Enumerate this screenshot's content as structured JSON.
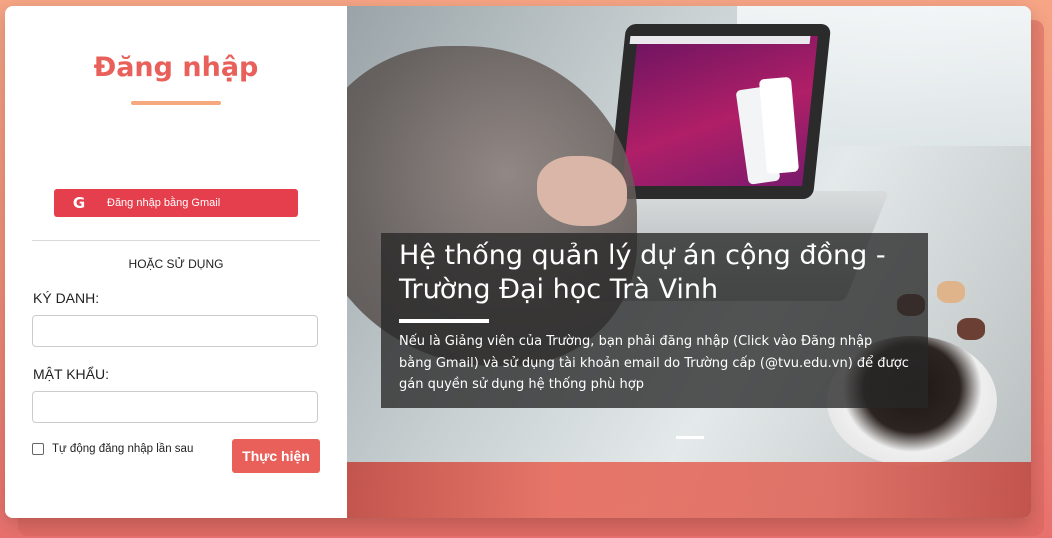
{
  "login": {
    "title": "Đăng nhập",
    "gmail_button": {
      "icon": "google-icon",
      "icon_glyph": "G",
      "label": "Đăng nhập bằng Gmail"
    },
    "or_text": "HOẶC SỬ DỤNG",
    "username_label": "KÝ DANH:",
    "username_value": "",
    "password_label": "MẬT KHẨU:",
    "password_value": "",
    "remember_label": "Tự động đăng nhập lần sau",
    "remember_checked": false,
    "submit_label": "Thực hiện"
  },
  "hero": {
    "caption_title": "Hệ thống quản lý dự án cộng đồng - Trường Đại học Trà Vinh",
    "caption_text": "Nếu là Giảng viên của Trường, bạn phải đăng nhập (Click vào Đăng nhập bằng Gmail) và sử dụng tài khoản email do Trường cấp (@tvu.edu.vn) để được gán quyền sử dụng hệ thống phù hợp",
    "slide_count": 1,
    "active_slide": 1
  },
  "colors": {
    "accent": "#e9605a",
    "gmail": "#e53e4c",
    "underline": "#f6a97e",
    "background_top": "#f6a585",
    "background_bottom": "#e8716d"
  }
}
